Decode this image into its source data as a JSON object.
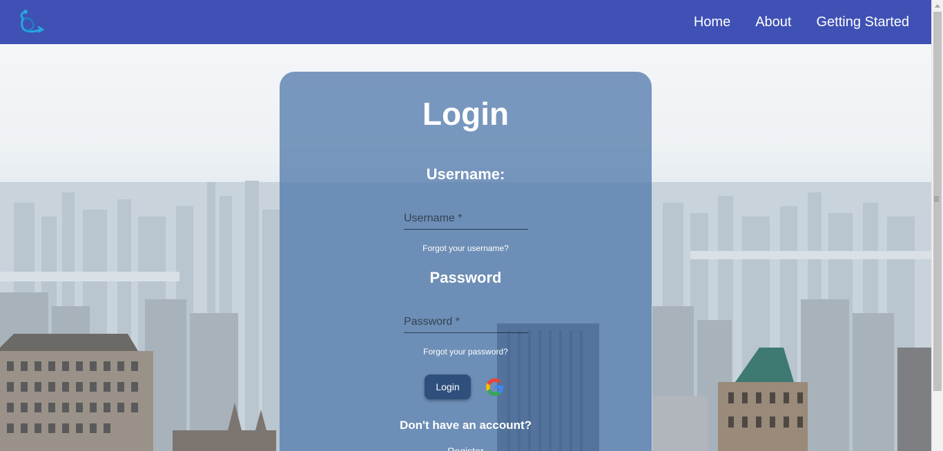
{
  "navbar": {
    "logo_icon": "app-logo-icon",
    "links": [
      "Home",
      "About",
      "Getting Started"
    ]
  },
  "login_card": {
    "title": "Login",
    "username_heading": "Username:",
    "username_placeholder": "Username *",
    "username_value": "",
    "forgot_username": "Forgot your username?",
    "password_heading": "Password",
    "password_placeholder": "Password *",
    "password_value": "",
    "forgot_password": "Forgot your password?",
    "login_button": "Login",
    "google_icon": "google-icon",
    "no_account": "Don't have an account?",
    "register_link": "Register"
  },
  "colors": {
    "navbar": "#3f51b5",
    "card": "#4a73a8",
    "login_button": "#2f4f7d"
  }
}
